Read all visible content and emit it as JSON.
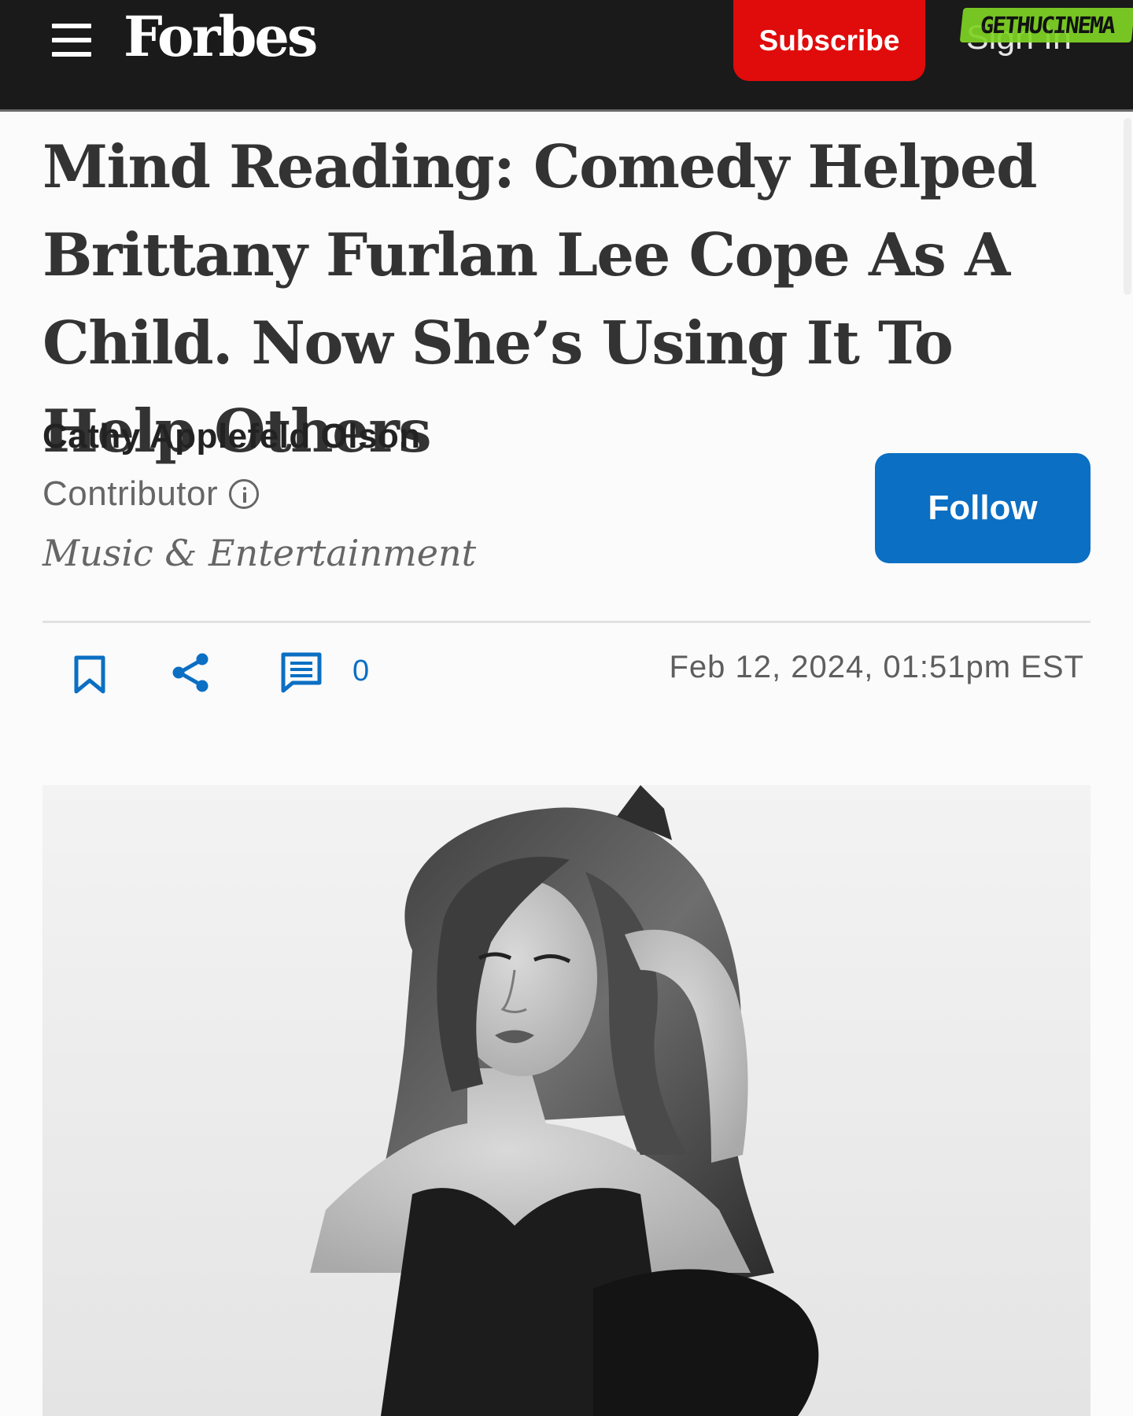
{
  "header": {
    "brand": "Forbes",
    "subscribe_label": "Subscribe",
    "signin_label": "Sign In",
    "watermark": "GETHUCINEMA"
  },
  "article": {
    "headline": "Mind Reading: Comedy Helped Brittany Furlan Lee Cope As A Child. Now She’s Using It To Help Others",
    "author": "Cathy Applefeld Olson",
    "role": "Contributor",
    "section": "Music & Entertainment",
    "follow_label": "Follow",
    "comment_count": "0",
    "date": "Feb 12, 2024, 01:51pm EST"
  },
  "icons": {
    "menu": "hamburger-menu-icon",
    "info": "info-icon",
    "bookmark": "bookmark-icon",
    "share": "share-icon",
    "comment": "comment-icon"
  },
  "colors": {
    "header_bg": "#1a1a1a",
    "subscribe_red": "#e00b0b",
    "follow_blue": "#0b6fc3",
    "headline_text": "#333333"
  }
}
